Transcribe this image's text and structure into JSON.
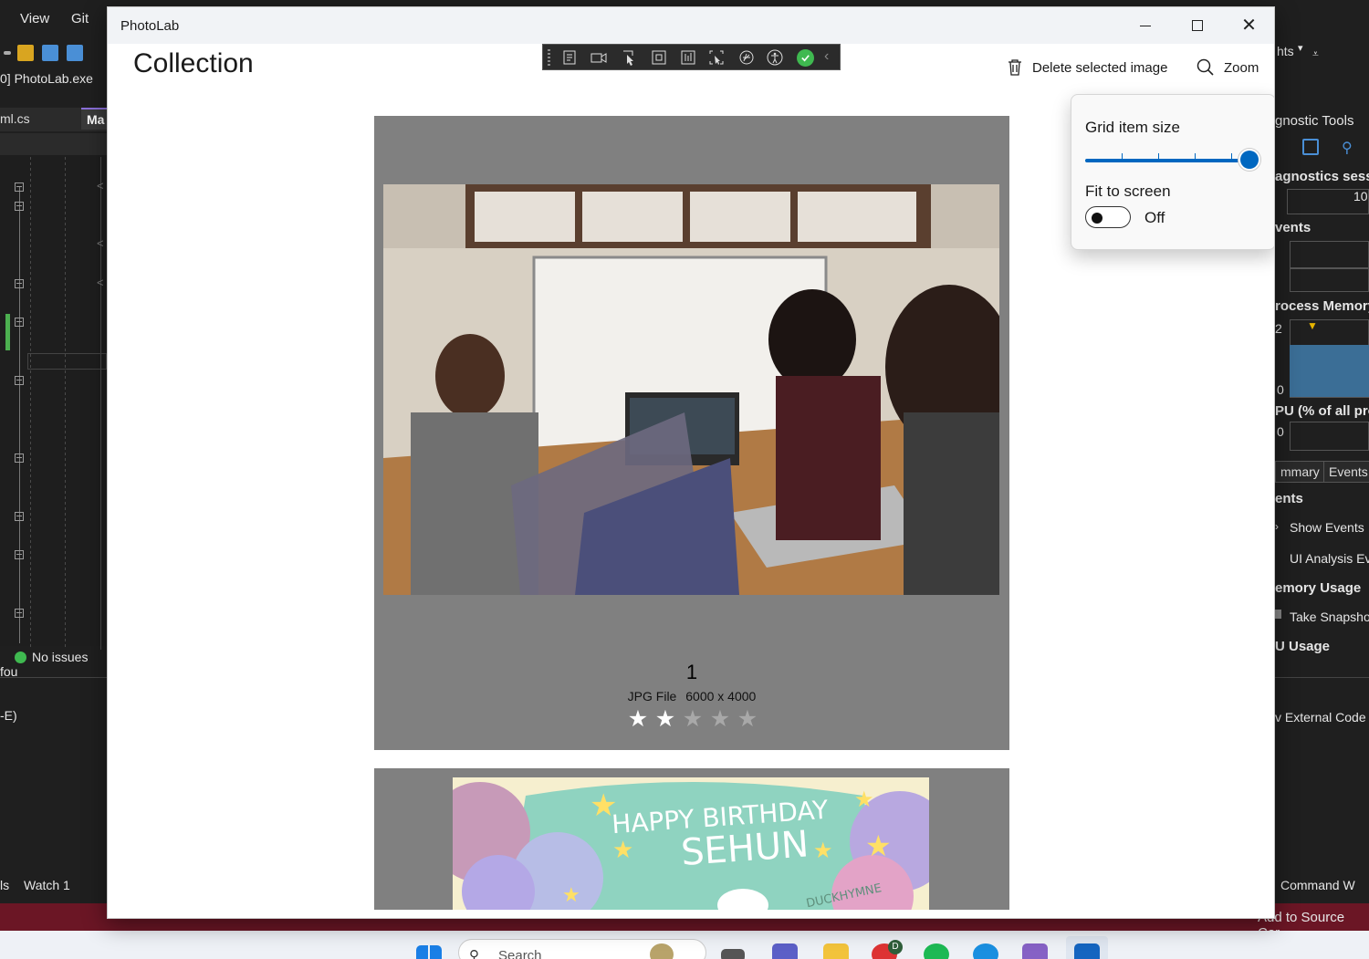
{
  "vs": {
    "menu": [
      "View",
      "Git"
    ],
    "process": "0] PhotoLab.exe",
    "tabs": [
      "ml.cs",
      "Ma"
    ],
    "status": "No issues fou",
    "e_label": "-E)",
    "watch_tabs": [
      "ls",
      "Watch 1"
    ],
    "highlights_menu": "hts",
    "bottom_status": "Add to Source Cor",
    "diagnostics": {
      "title": "gnostic Tools",
      "session": "agnostics sessic",
      "axis_right": "10",
      "events": "vents",
      "process_memory": "rocess Memory",
      "mem_top": "2",
      "mem_bottom": "0",
      "cpu": "PU (% of all pro",
      "cpu_val": "0",
      "tabs": [
        "mmary",
        "Events"
      ],
      "events_header": "ents",
      "show_events": "Show Events",
      "ui_analysis": "UI Analysis Ev",
      "memory_usage": "emory Usage",
      "take_snapshot": "Take Snapsho",
      "cpu_usage": "U Usage",
      "external_code": "v External Code",
      "command_window": "Command W"
    }
  },
  "taskbar": {
    "search_placeholder": "Search",
    "chrome_badge": "D"
  },
  "app": {
    "title": "PhotoLab",
    "heading": "Collection",
    "commands": {
      "delete": "Delete selected image",
      "zoom": "Zoom"
    },
    "zoom_flyout": {
      "grid_item_size_label": "Grid item size",
      "grid_item_size_value": 1.0,
      "fit_to_screen_label": "Fit to screen",
      "fit_to_screen_state": "Off"
    },
    "images": [
      {
        "number": "1",
        "file_type": "JPG File",
        "dimensions": "6000 x 4000",
        "rating": 2,
        "max_rating": 5
      },
      {
        "banner_line1": "HAPPY BIRTHDAY",
        "banner_line2": "SEHUN",
        "signature": "DUCKHYMNE"
      }
    ]
  },
  "colors": {
    "accent": "#0067c0",
    "card_bg": "#808080",
    "vs_bottombar": "#6b1625"
  }
}
